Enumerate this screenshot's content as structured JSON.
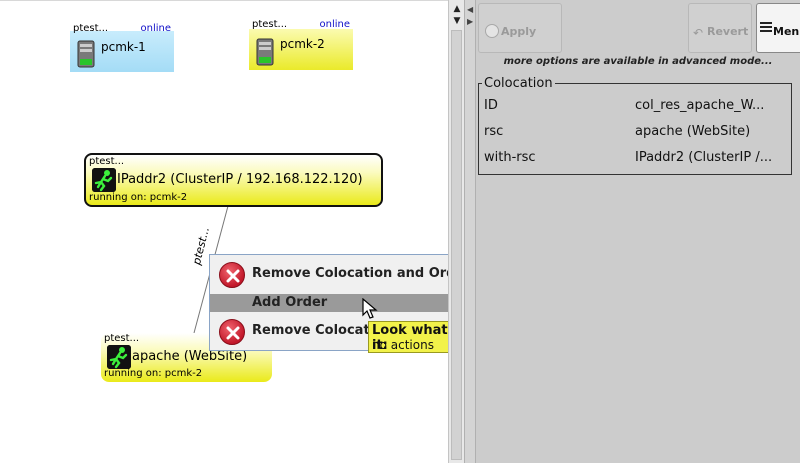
{
  "graph": {
    "hosts": [
      {
        "small_label": "ptest...",
        "status": "online",
        "name": "pcmk-1"
      },
      {
        "small_label": "ptest...",
        "status": "online",
        "name": "pcmk-2"
      }
    ],
    "resources": [
      {
        "small_label": "ptest...",
        "name": "IPaddr2 (ClusterIP / 192.168.122.120)",
        "running": "running on: pcmk-2"
      },
      {
        "small_label": "ptest...",
        "name": "apache (WebSite)",
        "running": "running on: pcmk-2"
      }
    ],
    "edge_label": "ptest..."
  },
  "context_menu": {
    "items": [
      {
        "label": "Remove Colocation and Order",
        "icon": "remove-icon"
      },
      {
        "label": "Add Order"
      },
      {
        "label": "Remove Colocati",
        "icon": "remove-icon"
      }
    ]
  },
  "tooltip": {
    "title": "Look what happens when you apply it:",
    "body": "no actions"
  },
  "toolbar": {
    "apply_label": "Apply",
    "revert_label": "Revert",
    "menu_label": "Men"
  },
  "panel": {
    "advanced_note": "more options are available in advanced mode...",
    "group_title": "Colocation",
    "rows": [
      {
        "key": "ID",
        "value": "col_res_apache_W..."
      },
      {
        "key": "rsc",
        "value": "apache (WebSite)"
      },
      {
        "key": "with-rsc",
        "value": "IPaddr2 (ClusterIP /..."
      }
    ]
  },
  "colors": {
    "host_blue": "#b4e4fa",
    "host_yellow": "#eeee3a",
    "resource_yellow": "#eaea1a",
    "tooltip_yellow": "#f2f24a",
    "remove_red": "#c2182a",
    "panel_gray": "#cccccc"
  }
}
